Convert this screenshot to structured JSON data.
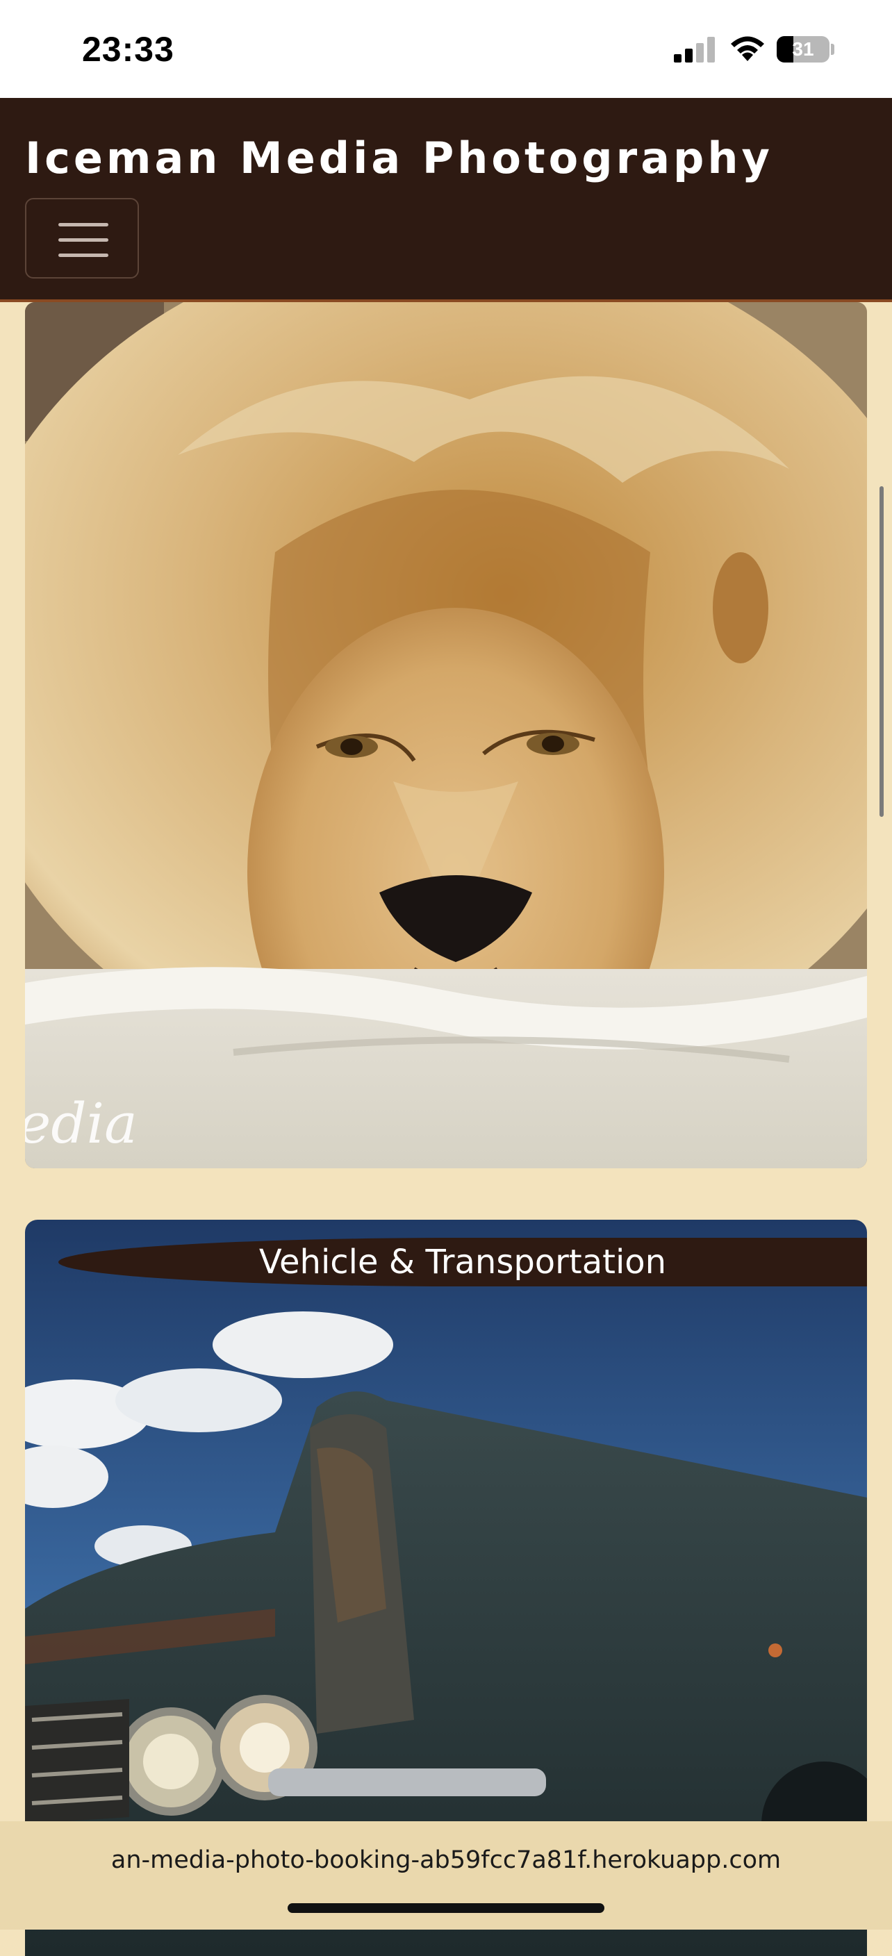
{
  "status_bar": {
    "time": "23:33",
    "battery": "31"
  },
  "header": {
    "brand": "Iceman Media Photography",
    "menu_icon": "hamburger-icon"
  },
  "cards": [
    {
      "category": "",
      "photo_subject": "lion",
      "watermark": "edia"
    },
    {
      "category": "Vehicle & Transportation",
      "photo_subject": "vintage car"
    }
  ],
  "browser": {
    "url": "an-media-photo-booking-ab59fcc7a81f.herokuapp.com"
  },
  "colors": {
    "page_bg": "#f3e3bd",
    "header_bg": "#2e1a12",
    "header_border": "#8a4a22"
  }
}
